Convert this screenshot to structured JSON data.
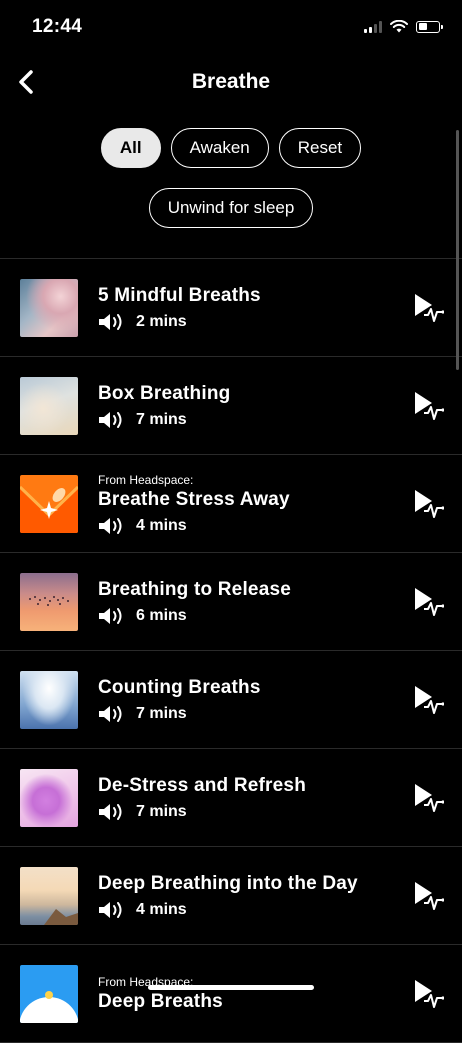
{
  "status_bar": {
    "time": "12:44"
  },
  "nav": {
    "title": "Breathe"
  },
  "filters": {
    "row1": [
      "All",
      "Awaken",
      "Reset"
    ],
    "row2": [
      "Unwind for sleep"
    ],
    "selected": "All"
  },
  "items": [
    {
      "from": "",
      "name": "5 Mindful Breaths",
      "duration": "2 mins"
    },
    {
      "from": "",
      "name": "Box Breathing",
      "duration": "7 mins"
    },
    {
      "from": "From Headspace:",
      "name": "Breathe Stress Away",
      "duration": "4 mins"
    },
    {
      "from": "",
      "name": "Breathing to Release",
      "duration": "6 mins"
    },
    {
      "from": "",
      "name": "Counting Breaths",
      "duration": "7 mins"
    },
    {
      "from": "",
      "name": "De-Stress and Refresh",
      "duration": "7 mins"
    },
    {
      "from": "",
      "name": "Deep Breathing into the Day",
      "duration": "4 mins"
    },
    {
      "from": "From Headspace:",
      "name": "Deep Breaths",
      "duration": ""
    }
  ],
  "colors": {
    "background": "#000000",
    "chip_active": "#e9e9e9",
    "text": "#ffffff"
  }
}
